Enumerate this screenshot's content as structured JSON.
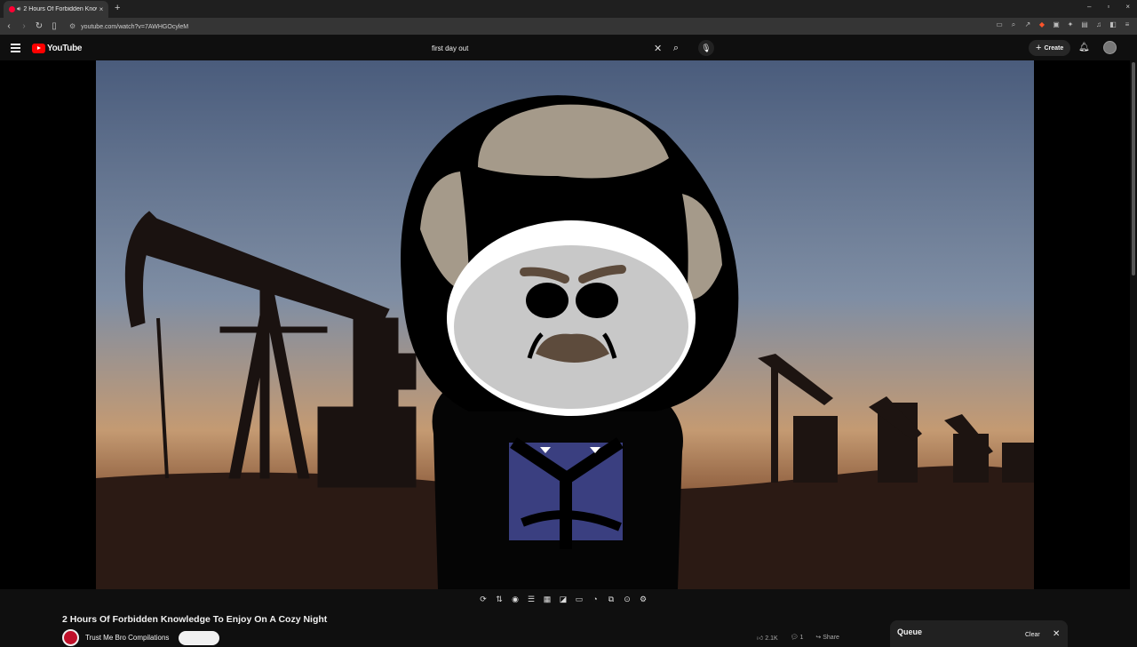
{
  "browser": {
    "tab_title": "2 Hours Of Forbidden Knowle",
    "tab_close": "×",
    "new_tab": "+",
    "url": "youtube.com/watch?v=7AWHGOcyleM",
    "window_controls": [
      "–",
      "▫",
      "×"
    ]
  },
  "youtube": {
    "logo_text": "YouTube",
    "search_query": "first day out",
    "create_label": "Create"
  },
  "video": {
    "title": "2 Hours Of Forbidden Knowledge To Enjoy On A Cozy Night",
    "channel": "Trust Me Bro Compilations",
    "likes": "2.1K",
    "comments": "1",
    "share_label": "Share"
  },
  "queue": {
    "title": "Queue",
    "clear_label": "Clear"
  },
  "icons": {
    "player_tools": [
      "loop-icon",
      "sort-icon",
      "audio-icon",
      "playlist-icon",
      "clapper-icon",
      "miniplayer-icon",
      "theater-icon",
      "speed-icon",
      "pip-icon",
      "screenshot-icon",
      "settings-icon"
    ]
  },
  "colors": {
    "brand_red": "#ff0000",
    "background": "#0f0f0f"
  }
}
